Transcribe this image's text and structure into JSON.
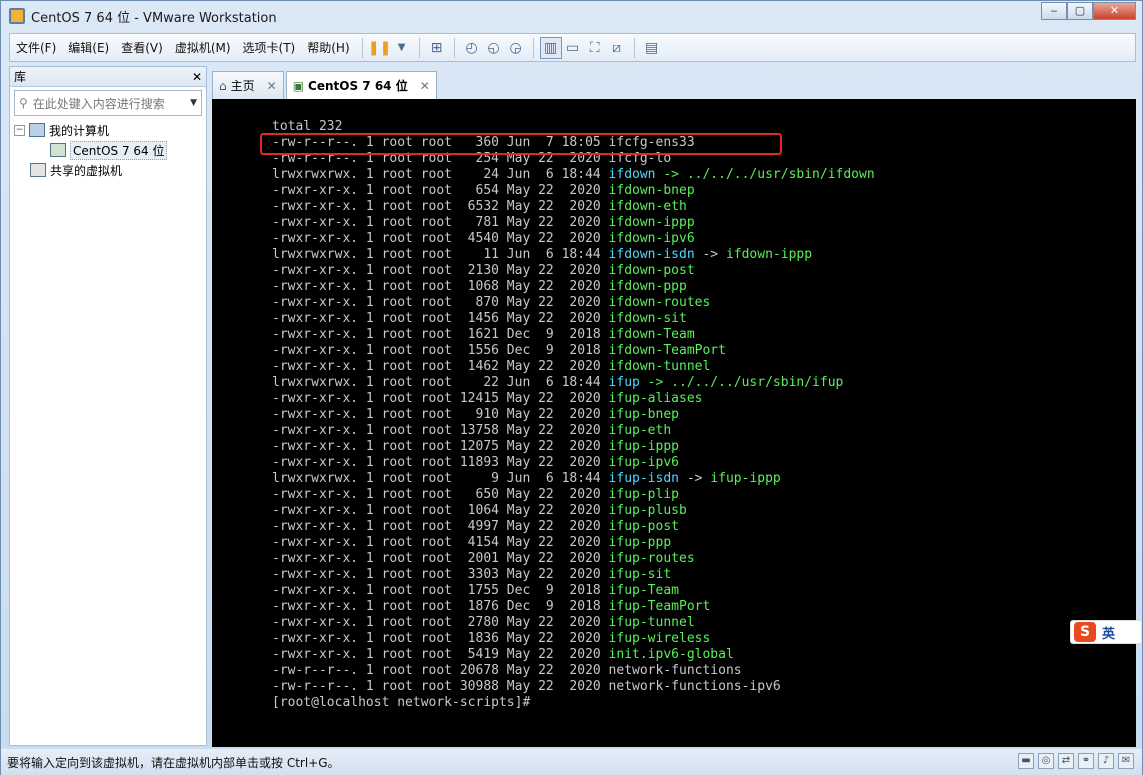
{
  "window": {
    "title": "CentOS 7 64 位 - VMware Workstation",
    "min": "‒",
    "max": "▢",
    "close": "✕"
  },
  "menu": [
    "文件(F)",
    "编辑(E)",
    "查看(V)",
    "虚拟机(M)",
    "选项卡(T)",
    "帮助(H)"
  ],
  "toolbar_icons": [
    "pause-icon",
    "dropdown-icon",
    "send-ctrl-alt-del-icon",
    "snapshot-icon",
    "revert-snapshot-icon",
    "snapshot-manager-icon",
    "normal-view-icon",
    "console-view-icon",
    "fullscreen-icon",
    "unity-icon",
    "thumbnail-icon"
  ],
  "library": {
    "title": "库",
    "close": "✕",
    "search_placeholder": "在此处键入内容进行搜索",
    "my_computer": "我的计算机",
    "vm": "CentOS 7 64 位",
    "shared": "共享的虚拟机"
  },
  "tabs": [
    {
      "label": "主页",
      "close": "✕"
    },
    {
      "label": "CentOS 7 64 位",
      "close": "✕"
    }
  ],
  "console": {
    "lines": [
      [
        {
          "t": "total 232",
          "c": "fl"
        }
      ],
      [
        {
          "t": "-rw-r--r--. 1 root root   360 Jun  7 18:05 ifcfg-ens33",
          "c": "fl"
        }
      ],
      [
        {
          "t": "-rw-r--r--. 1 root root   254 May 22  2020 ifcfg-lo",
          "c": "fl"
        }
      ],
      [
        {
          "t": "lrwxrwxrwx. 1 root root    24 Jun  6 18:44 ",
          "c": "fl"
        },
        {
          "t": "ifdown",
          "c": "fc"
        },
        {
          "t": " -> ../../../usr/sbin/ifdown",
          "c": "fg"
        }
      ],
      [
        {
          "t": "-rwxr-xr-x. 1 root root   654 May 22  2020 ",
          "c": "fl"
        },
        {
          "t": "ifdown-bnep",
          "c": "fg"
        }
      ],
      [
        {
          "t": "-rwxr-xr-x. 1 root root  6532 May 22  2020 ",
          "c": "fl"
        },
        {
          "t": "ifdown-eth",
          "c": "fg"
        }
      ],
      [
        {
          "t": "-rwxr-xr-x. 1 root root   781 May 22  2020 ",
          "c": "fl"
        },
        {
          "t": "ifdown-ippp",
          "c": "fg"
        }
      ],
      [
        {
          "t": "-rwxr-xr-x. 1 root root  4540 May 22  2020 ",
          "c": "fl"
        },
        {
          "t": "ifdown-ipv6",
          "c": "fg"
        }
      ],
      [
        {
          "t": "lrwxrwxrwx. 1 root root    11 Jun  6 18:44 ",
          "c": "fl"
        },
        {
          "t": "ifdown-isdn",
          "c": "fc"
        },
        {
          "t": " -> ",
          "c": "fl"
        },
        {
          "t": "ifdown-ippp",
          "c": "fg"
        }
      ],
      [
        {
          "t": "-rwxr-xr-x. 1 root root  2130 May 22  2020 ",
          "c": "fl"
        },
        {
          "t": "ifdown-post",
          "c": "fg"
        }
      ],
      [
        {
          "t": "-rwxr-xr-x. 1 root root  1068 May 22  2020 ",
          "c": "fl"
        },
        {
          "t": "ifdown-ppp",
          "c": "fg"
        }
      ],
      [
        {
          "t": "-rwxr-xr-x. 1 root root   870 May 22  2020 ",
          "c": "fl"
        },
        {
          "t": "ifdown-routes",
          "c": "fg"
        }
      ],
      [
        {
          "t": "-rwxr-xr-x. 1 root root  1456 May 22  2020 ",
          "c": "fl"
        },
        {
          "t": "ifdown-sit",
          "c": "fg"
        }
      ],
      [
        {
          "t": "-rwxr-xr-x. 1 root root  1621 Dec  9  2018 ",
          "c": "fl"
        },
        {
          "t": "ifdown-Team",
          "c": "fg"
        }
      ],
      [
        {
          "t": "-rwxr-xr-x. 1 root root  1556 Dec  9  2018 ",
          "c": "fl"
        },
        {
          "t": "ifdown-TeamPort",
          "c": "fg"
        }
      ],
      [
        {
          "t": "-rwxr-xr-x. 1 root root  1462 May 22  2020 ",
          "c": "fl"
        },
        {
          "t": "ifdown-tunnel",
          "c": "fg"
        }
      ],
      [
        {
          "t": "lrwxrwxrwx. 1 root root    22 Jun  6 18:44 ",
          "c": "fl"
        },
        {
          "t": "ifup",
          "c": "fc"
        },
        {
          "t": " -> ../../../usr/sbin/ifup",
          "c": "fg"
        }
      ],
      [
        {
          "t": "-rwxr-xr-x. 1 root root 12415 May 22  2020 ",
          "c": "fl"
        },
        {
          "t": "ifup-aliases",
          "c": "fg"
        }
      ],
      [
        {
          "t": "-rwxr-xr-x. 1 root root   910 May 22  2020 ",
          "c": "fl"
        },
        {
          "t": "ifup-bnep",
          "c": "fg"
        }
      ],
      [
        {
          "t": "-rwxr-xr-x. 1 root root 13758 May 22  2020 ",
          "c": "fl"
        },
        {
          "t": "ifup-eth",
          "c": "fg"
        }
      ],
      [
        {
          "t": "-rwxr-xr-x. 1 root root 12075 May 22  2020 ",
          "c": "fl"
        },
        {
          "t": "ifup-ippp",
          "c": "fg"
        }
      ],
      [
        {
          "t": "-rwxr-xr-x. 1 root root 11893 May 22  2020 ",
          "c": "fl"
        },
        {
          "t": "ifup-ipv6",
          "c": "fg"
        }
      ],
      [
        {
          "t": "lrwxrwxrwx. 1 root root     9 Jun  6 18:44 ",
          "c": "fl"
        },
        {
          "t": "ifup-isdn",
          "c": "fc"
        },
        {
          "t": " -> ",
          "c": "fl"
        },
        {
          "t": "ifup-ippp",
          "c": "fg"
        }
      ],
      [
        {
          "t": "-rwxr-xr-x. 1 root root   650 May 22  2020 ",
          "c": "fl"
        },
        {
          "t": "ifup-plip",
          "c": "fg"
        }
      ],
      [
        {
          "t": "-rwxr-xr-x. 1 root root  1064 May 22  2020 ",
          "c": "fl"
        },
        {
          "t": "ifup-plusb",
          "c": "fg"
        }
      ],
      [
        {
          "t": "-rwxr-xr-x. 1 root root  4997 May 22  2020 ",
          "c": "fl"
        },
        {
          "t": "ifup-post",
          "c": "fg"
        }
      ],
      [
        {
          "t": "-rwxr-xr-x. 1 root root  4154 May 22  2020 ",
          "c": "fl"
        },
        {
          "t": "ifup-ppp",
          "c": "fg"
        }
      ],
      [
        {
          "t": "-rwxr-xr-x. 1 root root  2001 May 22  2020 ",
          "c": "fl"
        },
        {
          "t": "ifup-routes",
          "c": "fg"
        }
      ],
      [
        {
          "t": "-rwxr-xr-x. 1 root root  3303 May 22  2020 ",
          "c": "fl"
        },
        {
          "t": "ifup-sit",
          "c": "fg"
        }
      ],
      [
        {
          "t": "-rwxr-xr-x. 1 root root  1755 Dec  9  2018 ",
          "c": "fl"
        },
        {
          "t": "ifup-Team",
          "c": "fg"
        }
      ],
      [
        {
          "t": "-rwxr-xr-x. 1 root root  1876 Dec  9  2018 ",
          "c": "fl"
        },
        {
          "t": "ifup-TeamPort",
          "c": "fg"
        }
      ],
      [
        {
          "t": "-rwxr-xr-x. 1 root root  2780 May 22  2020 ",
          "c": "fl"
        },
        {
          "t": "ifup-tunnel",
          "c": "fg"
        }
      ],
      [
        {
          "t": "-rwxr-xr-x. 1 root root  1836 May 22  2020 ",
          "c": "fl"
        },
        {
          "t": "ifup-wireless",
          "c": "fg"
        }
      ],
      [
        {
          "t": "-rwxr-xr-x. 1 root root  5419 May 22  2020 ",
          "c": "fl"
        },
        {
          "t": "init.ipv6-global",
          "c": "fg"
        }
      ],
      [
        {
          "t": "-rw-r--r--. 1 root root 20678 May 22  2020 network-functions",
          "c": "fl"
        }
      ],
      [
        {
          "t": "-rw-r--r--. 1 root root 30988 May 22  2020 network-functions-ipv6",
          "c": "fl"
        }
      ],
      [
        {
          "t": "[root@localhost network-scripts]# ",
          "c": "fl"
        }
      ]
    ]
  },
  "status_text": "要将输入定向到该虚拟机，请在虚拟机内部单击或按 Ctrl+G。",
  "ime": {
    "logo": "S",
    "lang": "英"
  },
  "colors": {
    "highlight": "#e02828",
    "file_exec": "#5af05a",
    "symlink": "#4fd8ff",
    "text": "#c8c8c8"
  }
}
